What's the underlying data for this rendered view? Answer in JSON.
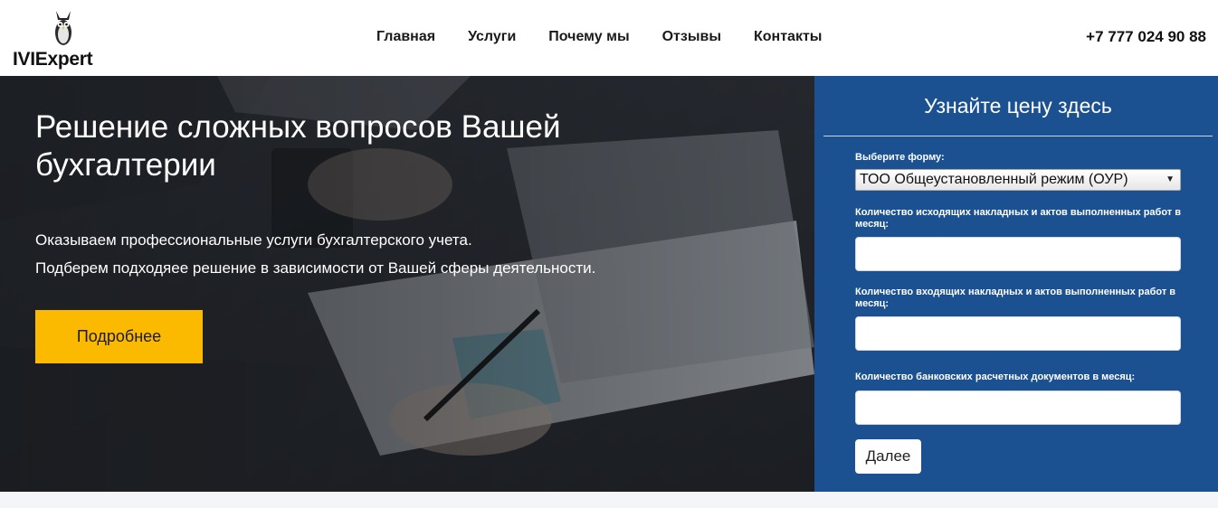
{
  "header": {
    "logo_text": "IVIExpert",
    "nav": [
      "Главная",
      "Услуги",
      "Почему мы",
      "Отзывы",
      "Контакты"
    ],
    "phone": "+7 777 024 90 88"
  },
  "hero": {
    "title": "Решение сложных вопросов Вашей бухгалтерии",
    "line1": "Оказываем профессиональные услуги бухгалтерского учета.",
    "line2": "Подберем подходяее решение в зависимости от Вашей сферы деятельности.",
    "button": "Подробнее"
  },
  "form": {
    "title": "Узнайте цену здесь",
    "select_label": "Выберите форму:",
    "select_value": "ТОО Общеустановленный режим (ОУР)",
    "field1_label": "Количество исходящих накладных и актов выполненных работ в месяц:",
    "field2_label": "Количество входящих накладных и актов выполненных работ в месяц:",
    "field3_label": "Количество банковских расчетных документов в месяц:",
    "field1_value": "",
    "field2_value": "",
    "field3_value": "",
    "button": "Далее"
  },
  "colors": {
    "accent": "#fbb900",
    "panel": "#1b5190"
  }
}
